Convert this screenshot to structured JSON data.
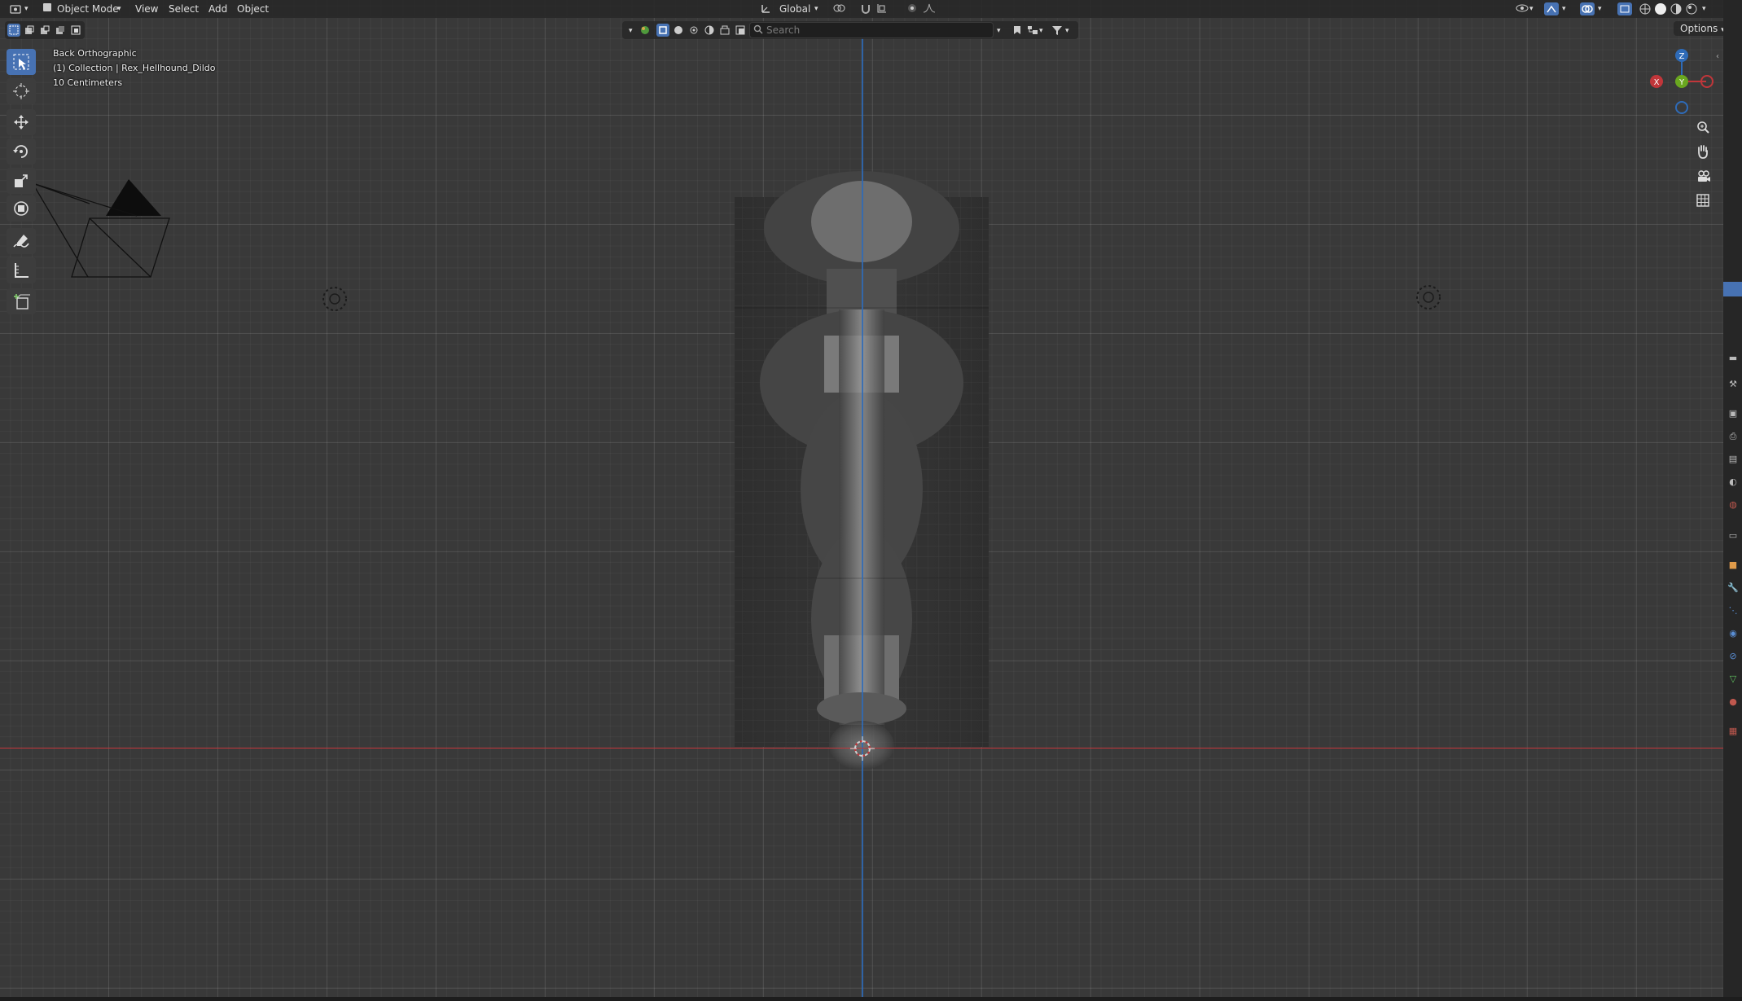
{
  "header": {
    "mode": "Object Mode",
    "menus": [
      "View",
      "Select",
      "Add",
      "Object"
    ],
    "transform_orientation": "Global",
    "options_label": "Options"
  },
  "search": {
    "placeholder": "Search"
  },
  "viewport_info": {
    "view_name": "Back Orthographic",
    "collection": "(1) Collection | Rex_Hellhound_Dildo",
    "scale": "10 Centimeters"
  },
  "gizmo": {
    "z": "Z",
    "x": "X",
    "y": "Y"
  },
  "colors": {
    "x_axis": "#c1363a",
    "y_axis": "#6aa71f",
    "z_axis": "#2e6bb8",
    "active_tool": "#4772b3",
    "viewport_bg": "#393939"
  },
  "toolbar": {
    "tools": [
      "select-box-icon",
      "cursor-icon",
      "move-icon",
      "rotate-icon",
      "scale-icon",
      "transform-icon",
      "annotate-icon",
      "measure-icon",
      "add-cube-icon"
    ]
  },
  "nav_buttons": [
    "zoom-icon",
    "pan-hand-icon",
    "camera-icon",
    "grid-perspective-icon"
  ]
}
